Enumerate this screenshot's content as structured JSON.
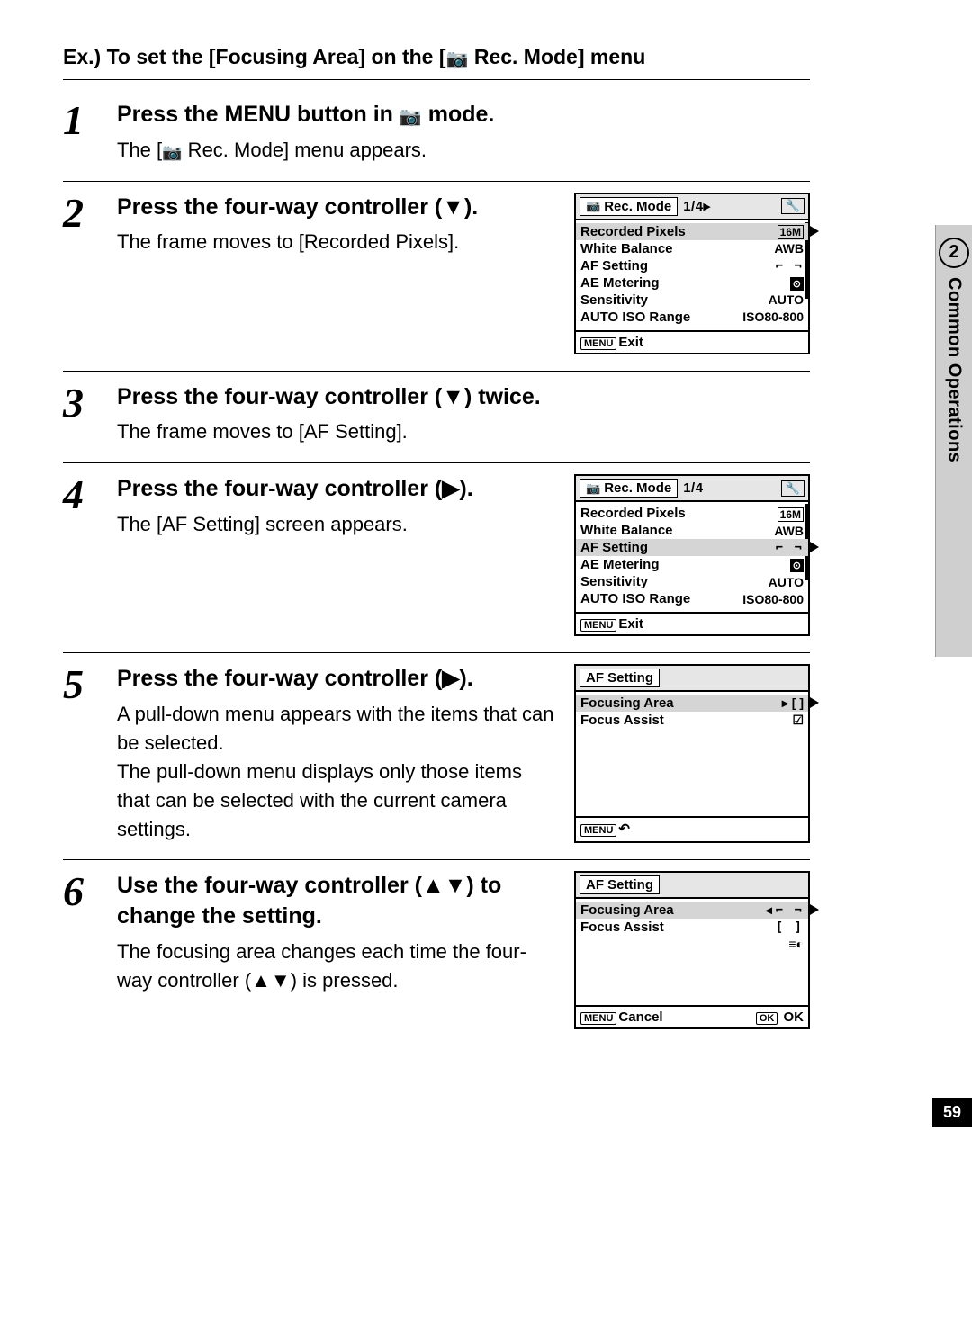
{
  "header": {
    "example_prefix": "Ex.) To set the [Focusing Area] on the [",
    "example_suffix": " Rec. Mode] menu"
  },
  "sidetab": {
    "num": "2",
    "label": "Common Operations"
  },
  "page_number": "59",
  "steps": [
    {
      "num": "1",
      "title_parts": [
        "Press the MENU button in ",
        " mode."
      ],
      "text": [
        "The [",
        " Rec. Mode] menu appears."
      ]
    },
    {
      "num": "2",
      "title": "Press the four-way controller (▼).",
      "text": "The frame moves to [Recorded Pixels].",
      "screen": {
        "title": "Rec. Mode",
        "page": "1/4",
        "page_arrow": "▸",
        "rows": [
          {
            "l": "Recorded Pixels",
            "v": "16M",
            "box": true,
            "sel": true
          },
          {
            "l": "White Balance",
            "v": "AWB"
          },
          {
            "l": "AF Setting",
            "v": "[ ]",
            "af": true
          },
          {
            "l": "AE Metering",
            "v": "⊙",
            "met": true
          },
          {
            "l": "Sensitivity",
            "v": "AUTO"
          },
          {
            "l": "AUTO ISO Range",
            "v": "ISO80-800"
          }
        ],
        "footer": "Exit"
      }
    },
    {
      "num": "3",
      "title": "Press the four-way controller (▼) twice.",
      "text": "The frame moves to [AF Setting]."
    },
    {
      "num": "4",
      "title": "Press the four-way controller (▶).",
      "text": "The [AF Setting] screen appears.",
      "screen": {
        "title": "Rec. Mode",
        "page": "1/4",
        "rows": [
          {
            "l": "Recorded Pixels",
            "v": "16M",
            "box": true
          },
          {
            "l": "White Balance",
            "v": "AWB"
          },
          {
            "l": "AF Setting",
            "v": "[ ]",
            "af": true,
            "sel": true
          },
          {
            "l": "AE Metering",
            "v": "⊙",
            "met": true
          },
          {
            "l": "Sensitivity",
            "v": "AUTO"
          },
          {
            "l": "AUTO ISO Range",
            "v": "ISO80-800"
          }
        ],
        "footer": "Exit"
      }
    },
    {
      "num": "5",
      "title": "Press the four-way controller (▶).",
      "text": "A pull-down menu appears with the items that can be selected.\nThe pull-down menu displays only those items that can be selected with the current camera settings.",
      "screen_af": {
        "title": "AF Setting",
        "rows": [
          {
            "l": "Focusing Area",
            "v": "▸ [ ]",
            "sel": true
          },
          {
            "l": "Focus Assist",
            "v": "☑"
          }
        ],
        "footer_icon": "↶"
      }
    },
    {
      "num": "6",
      "title": "Use the four-way controller (▲▼) to change the setting.",
      "text": "The focusing area changes each time the four-way controller (▲▼) is pressed.",
      "screen_af": {
        "title": "AF Setting",
        "rows": [
          {
            "l": "Focusing Area",
            "v": "◂ [ ]",
            "sel": true
          },
          {
            "l": "Focus Assist",
            "v": "[ ]",
            "stack": true
          }
        ],
        "footer_cancel": "Cancel",
        "footer_ok": "OK"
      }
    }
  ]
}
